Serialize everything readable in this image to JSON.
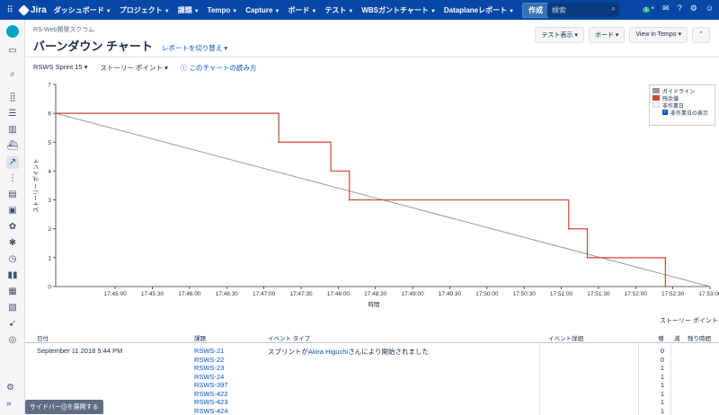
{
  "nav": {
    "product": "Jira",
    "items": [
      "ダッシュボード",
      "プロジェクト",
      "課題",
      "Tempo",
      "Capture",
      "ボード",
      "テスト",
      "WBSガントチャート",
      "Dataplaneレポート"
    ],
    "create": "作成",
    "search_placeholder": "検索",
    "notification_count": "1"
  },
  "header": {
    "project": "RS-Web開発スクラム",
    "title": "バーンダウン チャート",
    "switch_report": "レポートを切り替え",
    "buttons": [
      "テスト表示",
      "ボード",
      "View in Tempo"
    ]
  },
  "filters": {
    "sprint": "RSWS Sprint 15",
    "estimate": "ストーリー ポイント",
    "help": "このチャートの読み方"
  },
  "legend": {
    "guideline": "ガイドライン",
    "remaining": "残余値",
    "non_working": "非作業日",
    "show_non_working": "非作業日の表示"
  },
  "chart_data": {
    "type": "line",
    "title": "",
    "xlabel": "時間",
    "ylabel": "ストーリー ポイント",
    "ylim": [
      0,
      7
    ],
    "yticks": [
      "0",
      "1",
      "2",
      "3",
      "4",
      "5",
      "6",
      "7"
    ],
    "xticks": [
      "17:45:00",
      "17:45:30",
      "17:46:00",
      "17:46:30",
      "17:47:00",
      "17:47:30",
      "17:48:00",
      "17:48:30",
      "17:49:00",
      "17:49:30",
      "17:50:00",
      "17:50:30",
      "17:51:00",
      "17:51:30",
      "17:52:00",
      "17:52:30",
      "17:53:00"
    ],
    "xrange": [
      "17:44:12",
      "17:53:00"
    ],
    "guideline": {
      "color": "#999999",
      "points": [
        [
          "17:44:12",
          6
        ],
        [
          "17:53:00",
          0
        ]
      ]
    },
    "remaining": {
      "color": "#d04437",
      "step_points": [
        [
          "17:44:12",
          6
        ],
        [
          "17:47:12",
          5
        ],
        [
          "17:47:54",
          4
        ],
        [
          "17:48:09",
          3
        ],
        [
          "17:51:06",
          2
        ],
        [
          "17:51:21",
          1
        ],
        [
          "17:52:24",
          0
        ]
      ]
    }
  },
  "table": {
    "story_points_header": "ストーリー ポイント",
    "headers": {
      "date": "日付",
      "issue": "課題",
      "event_type": "イベント タイプ",
      "event_detail": "イベント詳細",
      "increase": "増",
      "decrease": "減",
      "remaining": "残り時間"
    },
    "row": {
      "date": "September 11 2018 5:44 PM",
      "issues": [
        "RSWS-21",
        "RSWS-22",
        "RSWS-23",
        "RSWS-24",
        "RSWS-397",
        "RSWS-422",
        "RSWS-423",
        "RSWS-424"
      ],
      "event_prefix": "スプリントが",
      "event_user": "Akira Higuchi",
      "event_suffix": "さんにより開始されました",
      "values": [
        "0",
        "0",
        "1",
        "1",
        "1",
        "1",
        "1",
        "1"
      ]
    }
  },
  "sidebar": {
    "expand_tooltip": "サイドバー([)を展開する"
  }
}
